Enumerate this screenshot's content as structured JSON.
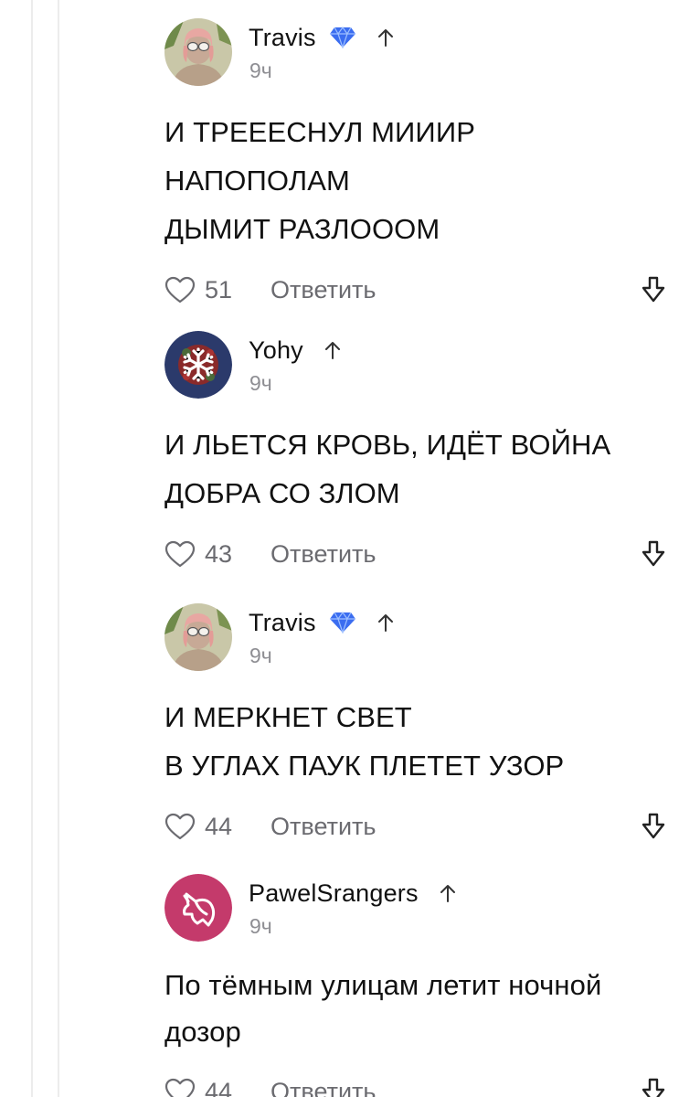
{
  "comments": [
    {
      "author": "Travis",
      "verified": true,
      "time": "9ч",
      "text": "И ТРЕЕЕСНУЛ МИИИР\nНАПОПОЛАМ\nДЫМИТ РАЗЛОООМ",
      "likes": "51",
      "reply_label": "Ответить"
    },
    {
      "author": "Yohy",
      "verified": false,
      "time": "9ч",
      "text": "И ЛЬЕТСЯ КРОВЬ, ИДЁТ ВОЙНА\nДОБРА СО ЗЛОМ",
      "likes": "43",
      "reply_label": "Ответить"
    },
    {
      "author": "Travis",
      "verified": true,
      "time": "9ч",
      "text": "И МЕРКНЕТ СВЕТ\nВ УГЛАХ ПАУК ПЛЕТЕТ УЗОР",
      "likes": "44",
      "reply_label": "Ответить"
    },
    {
      "author": "PawelSrangers",
      "verified": false,
      "time": "9ч",
      "text": "По тёмным улицам летит ночной\nдозор",
      "likes": "44",
      "reply_label": "Ответить"
    }
  ],
  "icons": {
    "verified": "diamond-badge-icon",
    "up": "arrow-up-icon",
    "like": "heart-outline-icon",
    "downvote": "arrow-down-icon"
  },
  "colors": {
    "text": "#111111",
    "muted": "#6b6b70",
    "verified_blue": "#3b6df0",
    "unicorn_avatar": "#c43a6b",
    "snowflake_avatar": "#2b3a6b"
  }
}
